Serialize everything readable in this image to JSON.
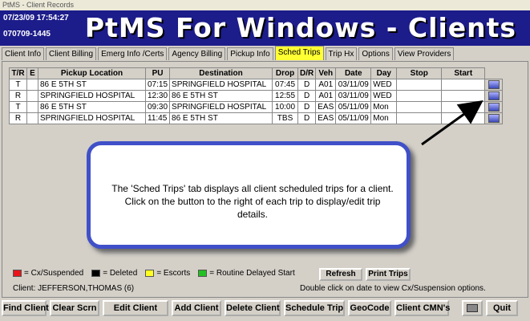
{
  "window": {
    "title": "PtMS - Client Records"
  },
  "banner": {
    "date_time": "07/23/09   17:54:27",
    "record_id": "070709-1445",
    "title": "PtMS For Windows - Clients"
  },
  "tabs": [
    "Client Info",
    "Client Billing",
    "Emerg Info /Certs",
    "Agency Billing",
    "Pickup Info",
    "Sched Trips",
    "Trip Hx",
    "Options",
    "View Providers"
  ],
  "active_tab": "Sched Trips",
  "table": {
    "headers": [
      "T/R",
      "E",
      "Pickup Location",
      "PU",
      "Destination",
      "Drop",
      "D/R",
      "Veh",
      "Date",
      "Day",
      "Stop",
      "Start"
    ],
    "rows": [
      [
        "T",
        "",
        "86 E 5TH ST",
        "07:15",
        "SPRINGFIELD HOSPITAL",
        "07:45",
        "D",
        "A01",
        "03/11/09",
        "WED",
        "",
        ""
      ],
      [
        "R",
        "",
        "SPRINGFIELD HOSPITAL",
        "12:30",
        "86 E 5TH ST",
        "12:55",
        "D",
        "A01",
        "03/11/09",
        "WED",
        "",
        ""
      ],
      [
        "T",
        "",
        "86 E 5TH ST",
        "09:30",
        "SPRINGFIELD HOSPITAL",
        "10:00",
        "D",
        "EAS",
        "05/11/09",
        "Mon",
        "",
        ""
      ],
      [
        "R",
        "",
        "SPRINGFIELD HOSPITAL",
        "11:45",
        "86 E 5TH ST",
        "TBS",
        "D",
        "EAS",
        "05/11/09",
        "Mon",
        "",
        ""
      ]
    ]
  },
  "callout": {
    "text": "The 'Sched Trips' tab displays all client scheduled trips for a client.  Click on the button to the right of each trip to display/edit trip details."
  },
  "legend": [
    {
      "label": "= Cx/Suspended",
      "color": "#e8141a"
    },
    {
      "label": "= Deleted",
      "color": "#000000"
    },
    {
      "label": "= Escorts",
      "color": "#ffff22"
    },
    {
      "label": "= Routine Delayed Start",
      "color": "#22c022"
    }
  ],
  "panel_buttons": {
    "refresh": "Refresh",
    "print_trips": "Print Trips"
  },
  "client": {
    "label": "Client:  JEFFERSON,THOMAS (6)"
  },
  "hint": "Double click on date to view Cx/Suspension options.",
  "bottom_buttons": [
    "Find Client",
    "Clear Scrn",
    "Edit Client",
    "Add Client",
    "Delete Client",
    "Schedule Trip",
    "GeoCode",
    "Client CMN's",
    "Quit"
  ]
}
